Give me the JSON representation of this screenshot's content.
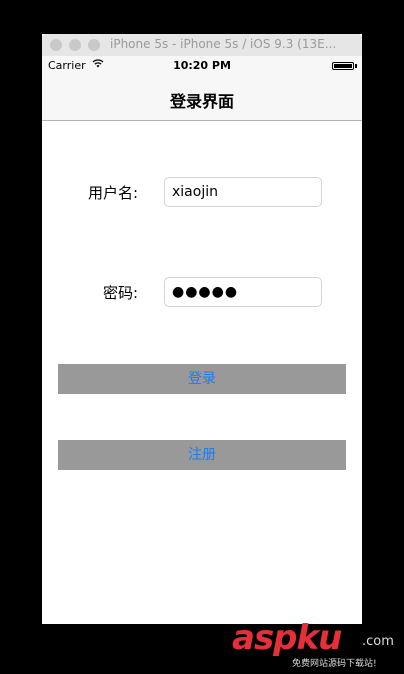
{
  "window": {
    "title": "iPhone 5s - iPhone 5s / iOS 9.3 (13E..."
  },
  "status_bar": {
    "carrier": "Carrier",
    "time": "10:20 PM",
    "wifi_icon": "wifi-icon",
    "battery_icon": "battery-icon",
    "battery_level": 1.0
  },
  "nav": {
    "title": "登录界面"
  },
  "form": {
    "username_label": "用户名:",
    "username_value": "xiaojin",
    "password_label": "密码:",
    "password_value": "●●●●●"
  },
  "buttons": {
    "login_label": "登录",
    "register_label": "注册"
  },
  "colors": {
    "button_bg": "#999999",
    "button_text": "#1a7cf5"
  },
  "watermark": {
    "brand": "aspku",
    "domain": ".com",
    "tagline": "免费网站源码下载站!"
  }
}
